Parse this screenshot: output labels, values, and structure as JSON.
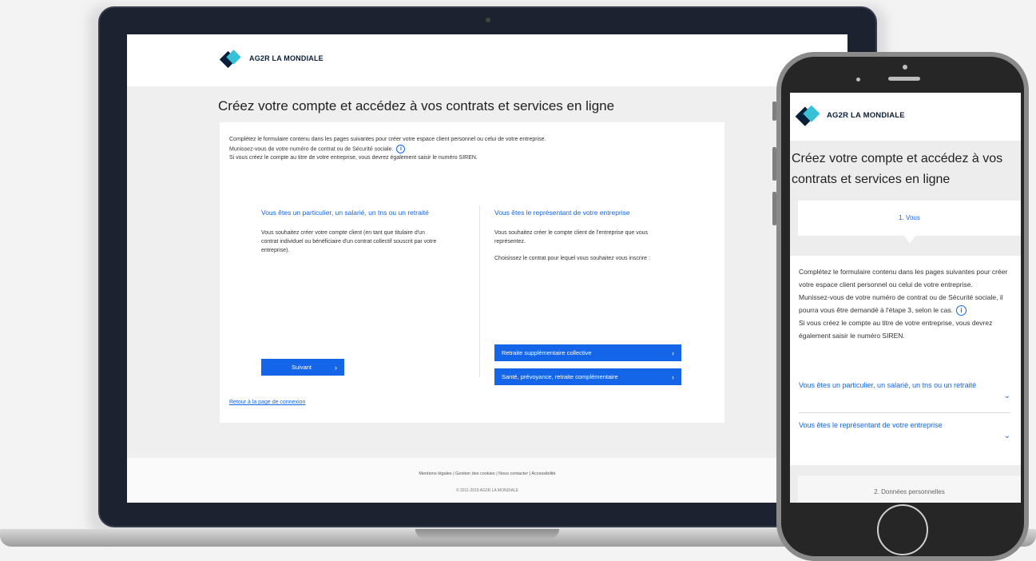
{
  "brand": {
    "name": "AG2R LA MONDIALE",
    "accent": "#1565e8",
    "logo_dark": "#0b1f3a",
    "logo_light": "#36c1d8"
  },
  "desktop": {
    "title": "Créez votre compte et accédez à vos contrats et services en ligne",
    "intro": {
      "line1": "Complétez le formulaire contenu dans les pages suivantes pour créer votre espace client personnel ou celui de votre entreprise.",
      "line2": "Munissez-vous de votre numéro de contrat ou de Sécurité sociale.",
      "line3": "Si vous créez le compte au titre de votre entreprise, vous devrez également saisir le numéro SIREN."
    },
    "individual": {
      "heading": "Vous êtes un particulier, un salarié, un tns ou un retraité",
      "text": "Vous souhaitez créer votre compte client (en tant que titulaire d'un contrat individuel ou bénéficiaire d'un contrat collectif souscrit par votre entreprise).",
      "button": "Suivant"
    },
    "company": {
      "heading": "Vous êtes le représentant de votre entreprise",
      "text1": "Vous souhaitez créer le compte client de l'entreprise que vous représentez.",
      "text2": "Choisissez le contrat pour lequel vous souhaitez vous inscrire :",
      "button1": "Retraite supplémentaire collective",
      "button2": "Santé, prévoyance, retraite complémentaire"
    },
    "back_link": "Retour à la page de connexion",
    "footer": {
      "links": "Mentions légales | Gestion des cookies | Nous contacter | Accessibilité",
      "copyright": "© 2011-2019 AG2R LA MONDIALE"
    }
  },
  "mobile": {
    "title": "Créez votre compte et accédez à vos contrats et services en ligne",
    "step1": "1. Vous",
    "intro": {
      "line1": "Complétez le formulaire contenu dans les pages suivantes pour créer votre espace client personnel ou celui de votre entreprise.",
      "line2": "Munissez-vous de votre numéro de contrat ou de Sécurité sociale, il pourra vous être demandé à l'étape 3, selon le cas.",
      "line3": "Si vous créez le compte au titre de votre entreprise, vous devrez également saisir le numéro SIREN."
    },
    "accordion1": "Vous êtes un particulier, un salarié, un tns ou un retraité",
    "accordion2": "Vous êtes le représentant de votre entreprise",
    "step2": "2. Données personnelles"
  },
  "icons": {
    "info": "info-icon",
    "chevron_right": "chevron-right-icon",
    "chevron_down": "chevron-down-icon"
  }
}
